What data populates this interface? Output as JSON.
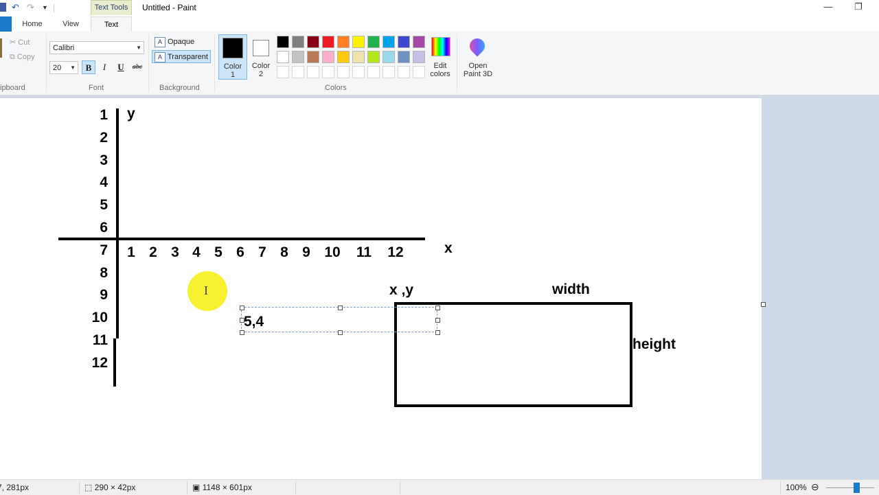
{
  "window": {
    "title": "Untitled - Paint",
    "context_tab_group": "Text Tools"
  },
  "tabs": {
    "home": "Home",
    "view": "View",
    "text": "Text"
  },
  "clipboard": {
    "cut": "Cut",
    "copy": "Copy",
    "group_label": "ipboard"
  },
  "font": {
    "family": "Calibri",
    "size": "20",
    "bold": "B",
    "italic": "I",
    "underline": "U",
    "strikethrough": "abc",
    "group_label": "Font"
  },
  "background": {
    "opaque": "Opaque",
    "transparent": "Transparent",
    "group_label": "Background"
  },
  "colors": {
    "color1_label_line1": "Color",
    "color1_label_line2": "1",
    "color2_label_line1": "Color",
    "color2_label_line2": "2",
    "color1": "#000000",
    "color2": "#ffffff",
    "edit_colors_line1": "Edit",
    "edit_colors_line2": "colors",
    "group_label": "Colors",
    "palette_row1": [
      "#000000",
      "#7f7f7f",
      "#880015",
      "#ed1c24",
      "#ff7f27",
      "#fff200",
      "#22b14c",
      "#00a2e8",
      "#3f48cc",
      "#a349a4"
    ],
    "palette_row2": [
      "#ffffff",
      "#c3c3c3",
      "#b97a57",
      "#ffaec9",
      "#ffc90e",
      "#efe4b0",
      "#b5e61d",
      "#99d9ea",
      "#7092be",
      "#c8bfe7"
    ]
  },
  "paint3d": {
    "line1": "Open",
    "line2": "Paint 3D"
  },
  "drawing": {
    "y_axis_label": "y",
    "x_axis_label": "x",
    "y_ticks": [
      "1",
      "2",
      "3",
      "4",
      "5",
      "6",
      "7",
      "8",
      "9",
      "10",
      "11",
      "12"
    ],
    "x_ticks": [
      "1",
      "2",
      "3",
      "4",
      "5",
      "6",
      "7",
      "8",
      "9",
      "10",
      "11",
      "12"
    ],
    "xy_label": "x ,y",
    "width_label": "width",
    "height_label": "height",
    "text_box_content": "5,4"
  },
  "status": {
    "cursor_pos": "7, 281px",
    "selection_size": "290 × 42px",
    "image_size": "1148 × 601px",
    "zoom": "100%"
  }
}
